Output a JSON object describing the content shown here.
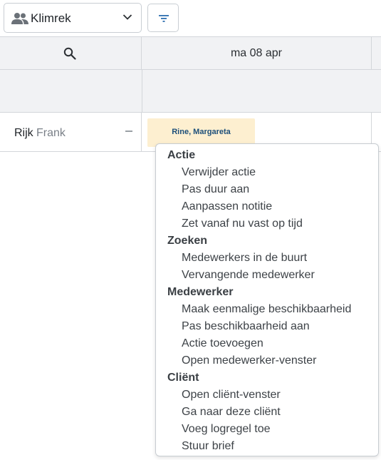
{
  "toolbar": {
    "group_selector": {
      "label": "Klimrek",
      "icon": "people-icon"
    },
    "filter_button": {
      "icon": "filter-icon"
    }
  },
  "grid": {
    "search_icon": "search-icon",
    "day_header": "ma 08 apr",
    "rows": [
      {
        "last_name": "Rijk",
        "first_name": "Frank",
        "appointment": "Rine, Margareta"
      }
    ]
  },
  "context_menu": {
    "sections": [
      {
        "title": "Actie",
        "items": [
          "Verwijder actie",
          "Pas duur aan",
          "Aanpassen notitie",
          "Zet vanaf nu vast op tijd"
        ]
      },
      {
        "title": "Zoeken",
        "items": [
          "Medewerkers in de buurt",
          "Vervangende medewerker"
        ]
      },
      {
        "title": "Medewerker",
        "items": [
          "Maak eenmalige beschikbaarheid",
          "Pas beschikbaarheid aan",
          "Actie toevoegen",
          "Open medewerker-venster"
        ]
      },
      {
        "title": "Cliënt",
        "items": [
          "Open cliënt-venster",
          "Ga naar deze cliënt",
          "Voeg logregel toe",
          "Stuur brief"
        ]
      }
    ]
  },
  "colors": {
    "header_bg": "#f1f2f4",
    "border": "#d3d6da",
    "appointment_bg": "#fdefd0",
    "appointment_text": "#1d4f7a"
  }
}
